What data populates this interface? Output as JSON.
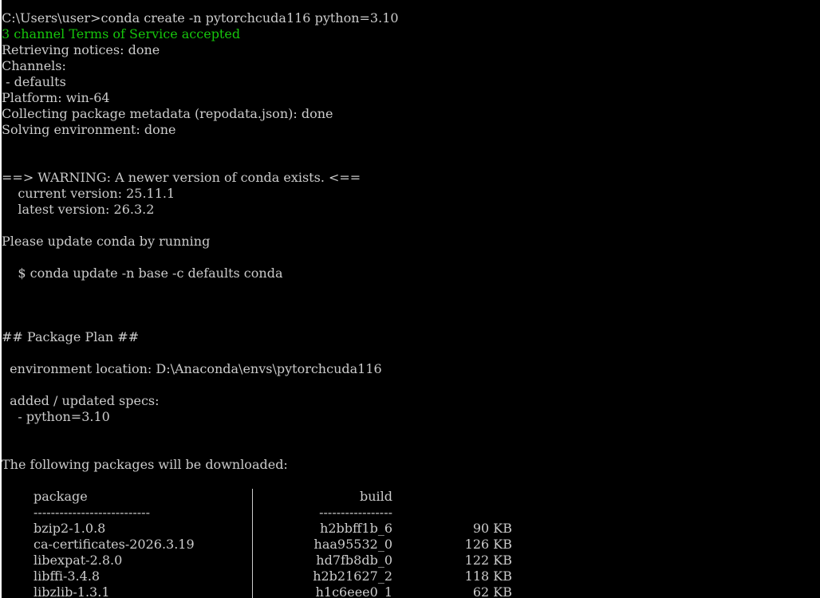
{
  "console": {
    "lines": [
      "C:\\Users\\user>conda create -n pytorchcuda116 python=3.10",
      "3 channel Terms of Service accepted",
      "Retrieving notices: done",
      "Channels:",
      " - defaults",
      "Platform: win-64",
      "Collecting package metadata (repodata.json): done",
      "Solving environment: done",
      "",
      "",
      "==> WARNING: A newer version of conda exists. <==",
      "    current version: 25.11.1",
      "    latest version: 26.3.2",
      "",
      "Please update conda by running",
      "",
      "    $ conda update -n base -c defaults conda",
      "",
      "",
      "",
      "## Package Plan ##",
      "",
      "  environment location: D:\\Anaconda\\envs\\pytorchcuda116",
      "",
      "  added / updated specs:",
      "    - python=3.10",
      "",
      "",
      "The following packages will be downloaded:",
      ""
    ],
    "table": {
      "header_package": "package",
      "header_build": "build",
      "sep_package": "---------------------------",
      "sep_build": "-----------------",
      "rows": [
        {
          "package": "bzip2-1.0.8",
          "build": "h2bbff1b_6",
          "size": "90 KB"
        },
        {
          "package": "ca-certificates-2026.3.19",
          "build": "haa95532_0",
          "size": "126 KB"
        },
        {
          "package": "libexpat-2.8.0",
          "build": "hd7fb8db_0",
          "size": "122 KB"
        },
        {
          "package": "libffi-3.4.8",
          "build": "h2b21627_2",
          "size": "118 KB"
        },
        {
          "package": "libzlib-1.3.1",
          "build": "h1c6eee0_1",
          "size": "62 KB"
        }
      ]
    }
  },
  "colors": {
    "background": "#000000",
    "text": "#cccccc",
    "accepted": "#16c60c"
  }
}
